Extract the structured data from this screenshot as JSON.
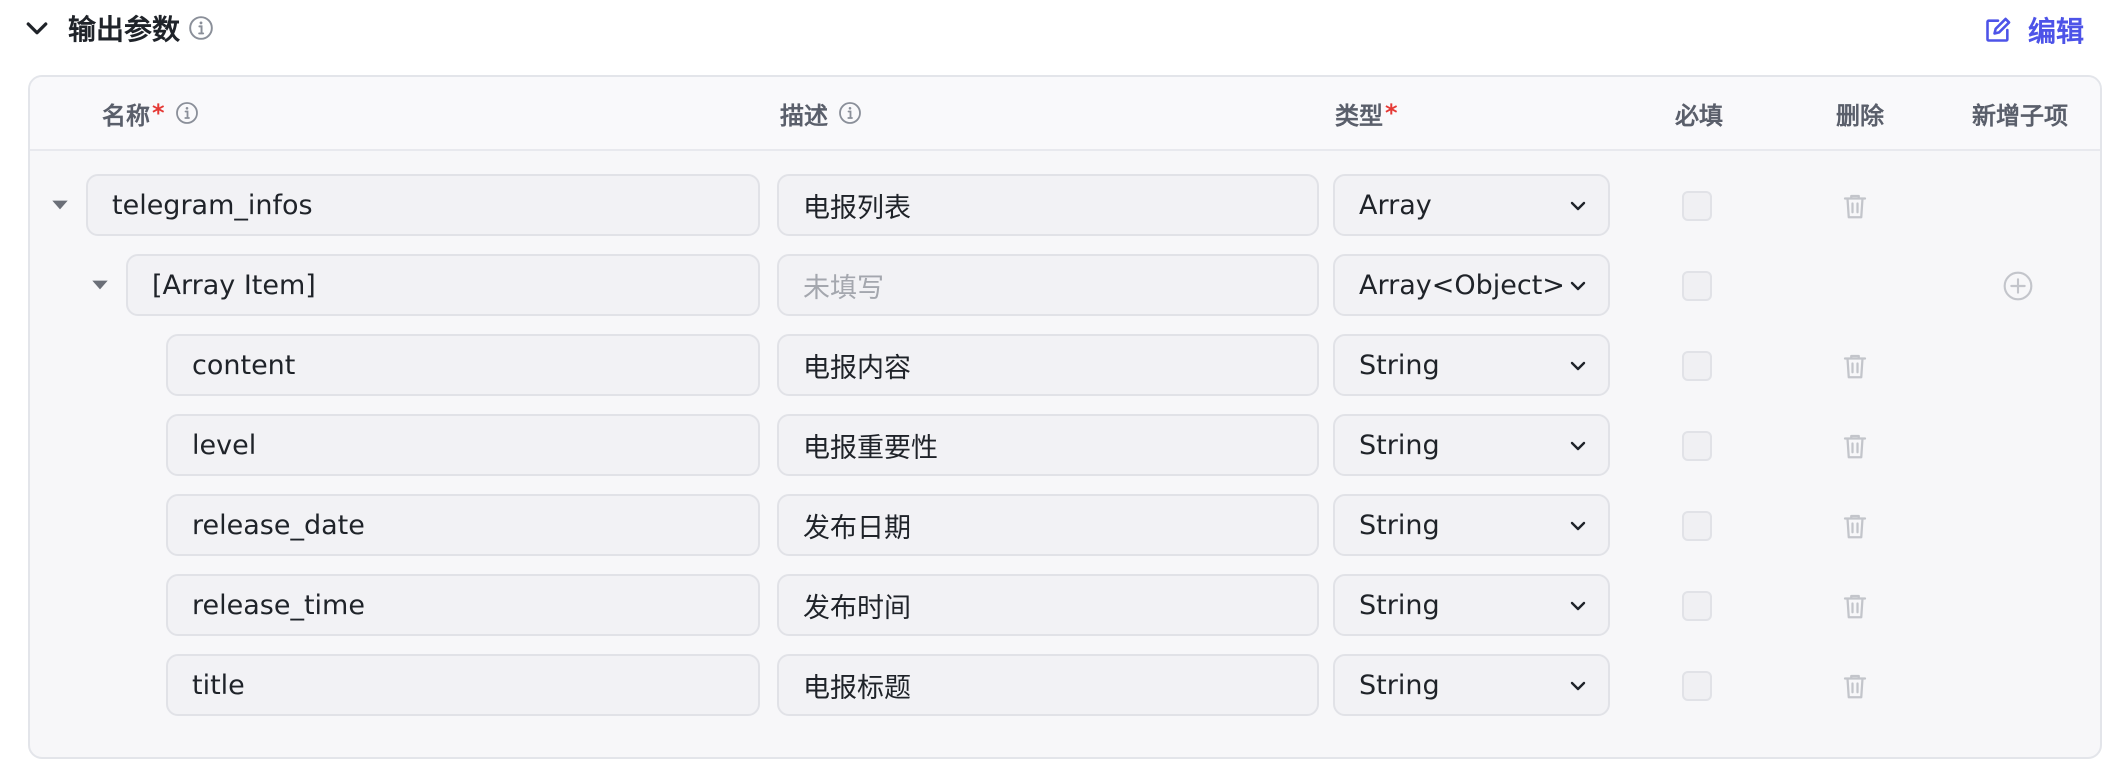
{
  "header": {
    "title": "输出参数",
    "edit_label": "编辑"
  },
  "columns": {
    "name": "名称",
    "description": "描述",
    "type": "类型",
    "required": "必填",
    "delete": "删除",
    "add_child": "新增子项",
    "required_mark": "*"
  },
  "rows": [
    {
      "name": "telegram_infos",
      "description": "电报列表",
      "type": "Array",
      "expanded": true,
      "level": 0
    },
    {
      "name": "[Array Item]",
      "description": "",
      "description_placeholder": "未填写",
      "type": "Array<Object>",
      "expanded": true,
      "level": 1
    },
    {
      "name": "content",
      "description": "电报内容",
      "type": "String",
      "level": 2
    },
    {
      "name": "level",
      "description": "电报重要性",
      "type": "String",
      "level": 2
    },
    {
      "name": "release_date",
      "description": "发布日期",
      "type": "String",
      "level": 2
    },
    {
      "name": "release_time",
      "description": "发布时间",
      "type": "String",
      "level": 2
    },
    {
      "name": "title",
      "description": "电报标题",
      "type": "String",
      "level": 2
    }
  ],
  "colors": {
    "accent": "#4d53e8",
    "required": "#e53935"
  }
}
